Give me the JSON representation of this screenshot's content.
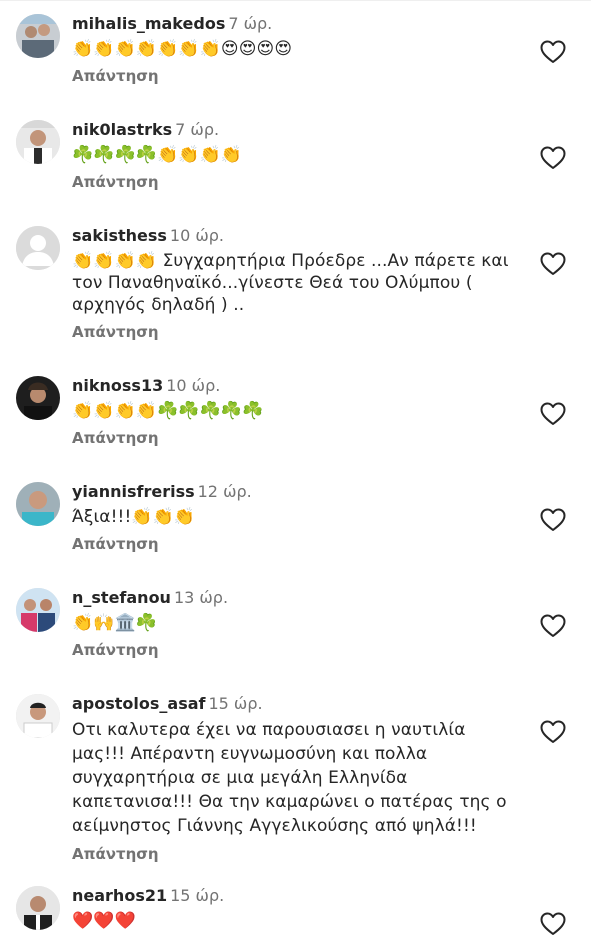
{
  "reply_label": "Απάντηση",
  "comments": [
    {
      "username": "mihalis_makedos",
      "time": "7 ώρ.",
      "text": "👏👏👏👏👏👏👏😍😍😍😍"
    },
    {
      "username": "nik0lastrks",
      "time": "7 ώρ.",
      "text": "☘️☘️☘️☘️👏👏👏👏"
    },
    {
      "username": "sakisthess",
      "time": "10 ώρ.",
      "text": "👏👏👏👏 Συγχαρητήρια Πρόεδρε ...Αν πάρετε και τον Παναθηναϊκό...γίνεστε Θεά του Ολύμπου ( αρχηγός δηλαδή ) .."
    },
    {
      "username": "niknoss13",
      "time": "10 ώρ.",
      "text": "👏👏👏👏☘️☘️☘️☘️☘️"
    },
    {
      "username": "yiannisfreriss",
      "time": "12 ώρ.",
      "text": "Άξια!!!👏👏👏"
    },
    {
      "username": "n_stefanou",
      "time": "13 ώρ.",
      "text": "👏🙌🏛️☘️"
    },
    {
      "username": "apostolos_asaf",
      "time": "15 ώρ.",
      "text": "Οτι καλυτερα έχει να παρουσιασει η ναυτιλία μας!!! Απέραντη ευγνωμοσύνη και πολλα συγχαρητήρια σε μια μεγάλη Ελληνίδα καπετανισα!!! Θα την καμαρώνει ο πατέρας της ο αείμνηστος Γιάννης Αγγελικούσης από ψηλά!!!"
    },
    {
      "username": "nearhos21",
      "time": "15 ώρ.",
      "text": "❤️❤️❤️"
    }
  ],
  "colors": {
    "text": "#262626",
    "secondary": "#737373",
    "background": "#ffffff"
  },
  "icons": {
    "like": "heart-outline-icon",
    "default_avatar": "default-avatar-icon"
  }
}
